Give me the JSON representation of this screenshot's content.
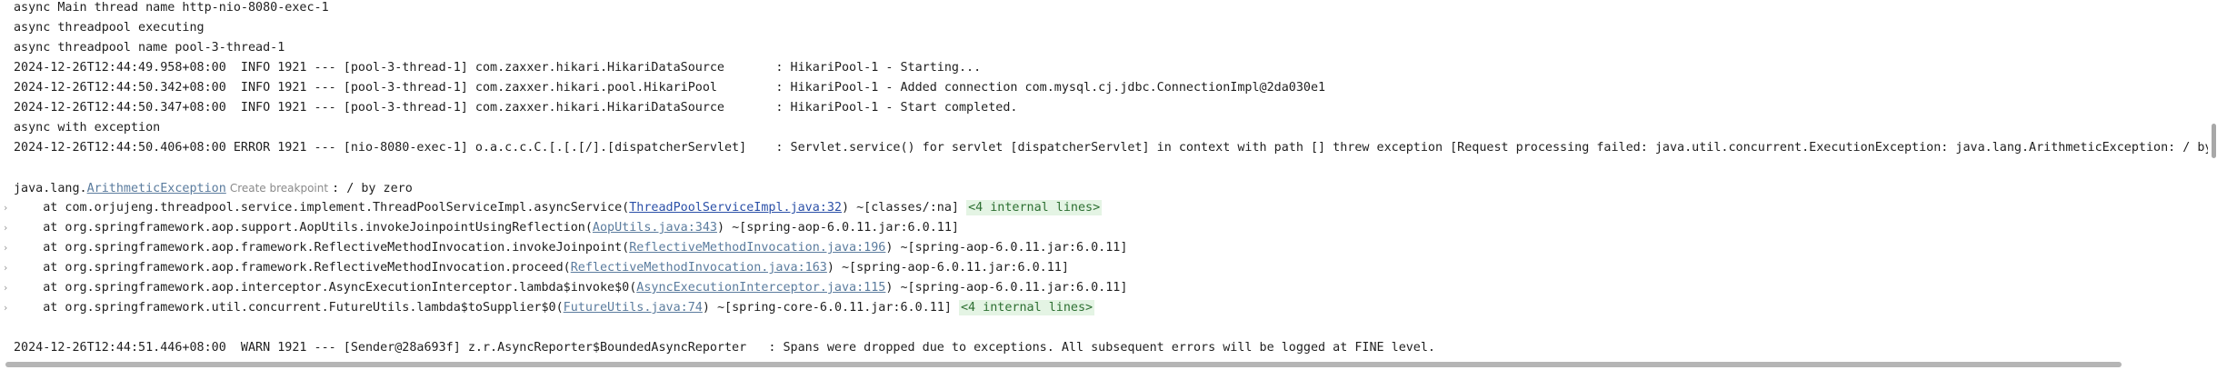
{
  "console": {
    "pre_lines": [
      "async Main thread name http-nio-8080-exec-1",
      "async threadpool executing",
      "async threadpool name pool-3-thread-1",
      "2024-12-26T12:44:49.958+08:00  INFO 1921 --- [pool-3-thread-1] com.zaxxer.hikari.HikariDataSource       : HikariPool-1 - Starting...",
      "2024-12-26T12:44:50.342+08:00  INFO 1921 --- [pool-3-thread-1] com.zaxxer.hikari.pool.HikariPool        : HikariPool-1 - Added connection com.mysql.cj.jdbc.ConnectionImpl@2da030e1",
      "2024-12-26T12:44:50.347+08:00  INFO 1921 --- [pool-3-thread-1] com.zaxxer.hikari.HikariDataSource       : HikariPool-1 - Start completed.",
      "async with exception",
      "2024-12-26T12:44:50.406+08:00 ERROR 1921 --- [nio-8080-exec-1] o.a.c.c.C.[.[.[/].[dispatcherServlet]    : Servlet.service() for servlet [dispatcherServlet] in context with path [] threw exception [Request processing failed: java.util.concurrent.ExecutionException: java.lang.ArithmeticException: / by zero] wit"
    ],
    "exception": {
      "prefix": "java.lang.",
      "class_link": "ArithmeticException",
      "hint": "Create breakpoint",
      "message": ": / by zero"
    },
    "stack": [
      {
        "before": "    at com.orjujeng.threadpool.service.implement.ThreadPoolServiceImpl.asyncService(",
        "link": "ThreadPoolServiceImpl.java:32",
        "after": ") ~[classes/:na] ",
        "badge": "<4 internal lines>",
        "primary": true
      },
      {
        "before": "    at org.springframework.aop.support.AopUtils.invokeJoinpointUsingReflection(",
        "link": "AopUtils.java:343",
        "after": ") ~[spring-aop-6.0.11.jar:6.0.11]",
        "badge": ""
      },
      {
        "before": "    at org.springframework.aop.framework.ReflectiveMethodInvocation.invokeJoinpoint(",
        "link": "ReflectiveMethodInvocation.java:196",
        "after": ") ~[spring-aop-6.0.11.jar:6.0.11]",
        "badge": ""
      },
      {
        "before": "    at org.springframework.aop.framework.ReflectiveMethodInvocation.proceed(",
        "link": "ReflectiveMethodInvocation.java:163",
        "after": ") ~[spring-aop-6.0.11.jar:6.0.11]",
        "badge": ""
      },
      {
        "before": "    at org.springframework.aop.interceptor.AsyncExecutionInterceptor.lambda$invoke$0(",
        "link": "AsyncExecutionInterceptor.java:115",
        "after": ") ~[spring-aop-6.0.11.jar:6.0.11]",
        "badge": ""
      },
      {
        "before": "    at org.springframework.util.concurrent.FutureUtils.lambda$toSupplier$0(",
        "link": "FutureUtils.java:74",
        "after": ") ~[spring-core-6.0.11.jar:6.0.11] ",
        "badge": "<4 internal lines>"
      }
    ],
    "post_lines": [
      "2024-12-26T12:44:51.446+08:00  WARN 1921 --- [Sender@28a693f] z.r.AsyncReporter$BoundedAsyncReporter   : Spans were dropped due to exceptions. All subsequent errors will be logged at FINE level."
    ],
    "fold_icon": "chevron-right-icon",
    "colors": {
      "text": "#1f1f1f",
      "link": "#5b7c9e",
      "primary_link": "#2b50a8",
      "badge_bg": "#e4f4e4",
      "badge_fg": "#2d6f32"
    }
  }
}
